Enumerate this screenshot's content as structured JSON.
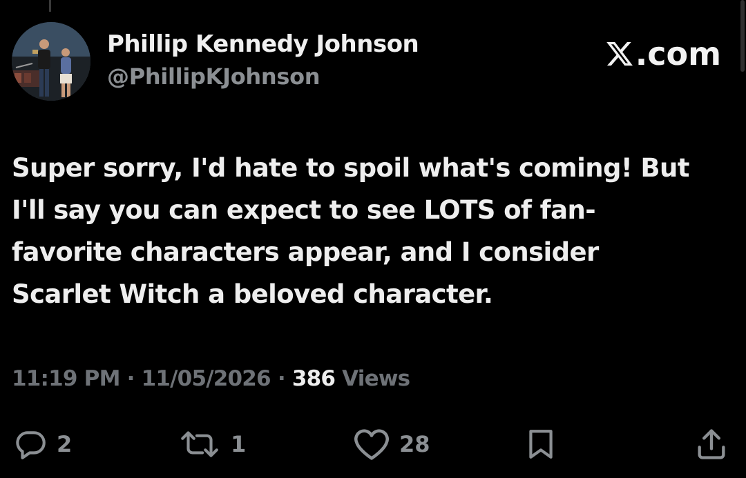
{
  "author": {
    "name": "Phillip Kennedy Johnson",
    "handle": "@PhillipKJohnson",
    "avatar_icon": "profile-photo"
  },
  "brand": {
    "label": ".com",
    "icon": "x-logo-icon"
  },
  "tweet": {
    "lines": [
      "Super sorry, I'd hate to spoil what's coming! But",
      "I'll say you can expect to see LOTS of fan-",
      "favorite characters appear, and I consider",
      "Scarlet Witch a beloved character."
    ]
  },
  "meta": {
    "time": "11:19 PM",
    "date": "11/05/2026",
    "views_count": "386",
    "views_label": "Views",
    "separator": "·"
  },
  "actions": {
    "replies": {
      "icon": "reply-icon",
      "count": "2"
    },
    "reposts": {
      "icon": "repost-icon",
      "count": "1"
    },
    "likes": {
      "icon": "heart-icon",
      "count": "28"
    },
    "bookmark": {
      "icon": "bookmark-icon"
    },
    "share": {
      "icon": "share-icon"
    }
  },
  "colors": {
    "background": "#000000",
    "primary_text": "#eeeeee",
    "secondary_text": "#8b8f93",
    "meta_text": "#6e7277"
  }
}
